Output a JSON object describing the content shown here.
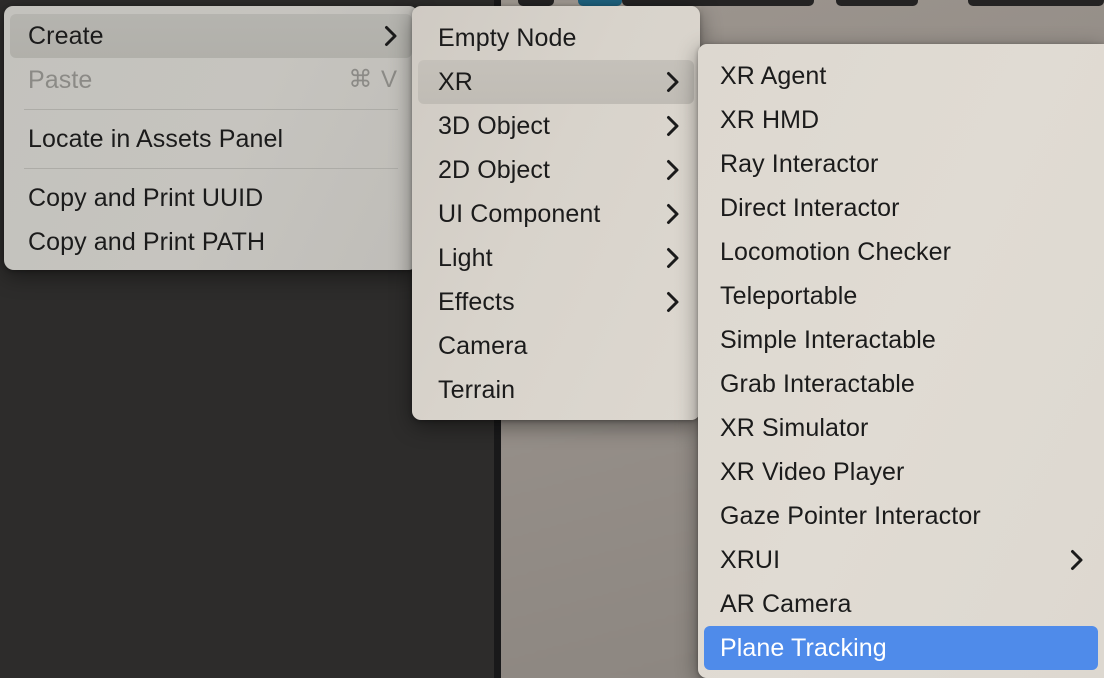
{
  "app": {
    "background_dark": "#2d2c2b",
    "background_pane": "#938c86",
    "highlight_blue": "#4f8bea",
    "highlight_gray": "#b3b2ad",
    "menu_bg_1": "#c4c2bd",
    "menu_bg_2": "#d8d3cb",
    "menu_bg_3": "#ded9d1"
  },
  "toolbar": {
    "buttons": [
      {
        "name": "toolbar-button-1",
        "color": "#242323"
      },
      {
        "name": "toolbar-button-active",
        "color": "#1e627f"
      },
      {
        "name": "toolbar-button-3",
        "color": "#242323"
      },
      {
        "name": "toolbar-button-4",
        "color": "#242323"
      },
      {
        "name": "toolbar-button-5",
        "color": "#242323"
      }
    ]
  },
  "context_menu": {
    "name": "node-context-menu",
    "items": [
      {
        "label": "Create",
        "submenu": true,
        "disabled": false,
        "highlighted": "gray",
        "shortcut": ""
      },
      {
        "label": "Paste",
        "submenu": false,
        "disabled": true,
        "highlighted": "",
        "shortcut": "⌘ V"
      },
      {
        "divider": true
      },
      {
        "label": "Locate in Assets Panel",
        "submenu": false,
        "disabled": false,
        "highlighted": "",
        "shortcut": ""
      },
      {
        "divider": true
      },
      {
        "label": "Copy and Print UUID",
        "submenu": false,
        "disabled": false,
        "highlighted": "",
        "shortcut": ""
      },
      {
        "label": "Copy and Print PATH",
        "submenu": false,
        "disabled": false,
        "highlighted": "",
        "shortcut": ""
      }
    ]
  },
  "create_submenu": {
    "name": "create-submenu",
    "items": [
      {
        "label": "Empty Node",
        "submenu": false,
        "highlighted": ""
      },
      {
        "label": "XR",
        "submenu": true,
        "highlighted": "gray"
      },
      {
        "label": "3D Object",
        "submenu": true,
        "highlighted": ""
      },
      {
        "label": "2D Object",
        "submenu": true,
        "highlighted": ""
      },
      {
        "label": "UI Component",
        "submenu": true,
        "highlighted": ""
      },
      {
        "label": "Light",
        "submenu": true,
        "highlighted": ""
      },
      {
        "label": "Effects",
        "submenu": true,
        "highlighted": ""
      },
      {
        "label": "Camera",
        "submenu": false,
        "highlighted": ""
      },
      {
        "label": "Terrain",
        "submenu": false,
        "highlighted": ""
      }
    ]
  },
  "xr_submenu": {
    "name": "xr-submenu",
    "items": [
      {
        "label": "XR Agent",
        "submenu": false,
        "highlighted": ""
      },
      {
        "label": "XR HMD",
        "submenu": false,
        "highlighted": ""
      },
      {
        "label": "Ray Interactor",
        "submenu": false,
        "highlighted": ""
      },
      {
        "label": "Direct Interactor",
        "submenu": false,
        "highlighted": ""
      },
      {
        "label": "Locomotion Checker",
        "submenu": false,
        "highlighted": ""
      },
      {
        "label": "Teleportable",
        "submenu": false,
        "highlighted": ""
      },
      {
        "label": "Simple Interactable",
        "submenu": false,
        "highlighted": ""
      },
      {
        "label": "Grab Interactable",
        "submenu": false,
        "highlighted": ""
      },
      {
        "label": "XR Simulator",
        "submenu": false,
        "highlighted": ""
      },
      {
        "label": "XR Video Player",
        "submenu": false,
        "highlighted": ""
      },
      {
        "label": "Gaze Pointer Interactor",
        "submenu": false,
        "highlighted": ""
      },
      {
        "label": "XRUI",
        "submenu": true,
        "highlighted": ""
      },
      {
        "label": "AR Camera",
        "submenu": false,
        "highlighted": ""
      },
      {
        "label": "Plane Tracking",
        "submenu": false,
        "highlighted": "blue"
      }
    ]
  }
}
